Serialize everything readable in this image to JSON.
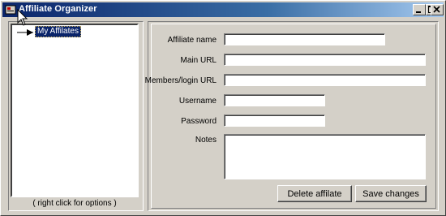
{
  "window": {
    "title": "Affiliate Organizer",
    "minimize_icon": "minimize-icon",
    "maximize_icon": "maximize-icon",
    "close_icon": "close-icon"
  },
  "tree": {
    "root_label": "My Affilates",
    "hint": "( right click for options )"
  },
  "form": {
    "affiliate_name_label": "Affiliate name",
    "main_url_label": "Main URL",
    "members_url_label": "Members/login URL",
    "username_label": "Username",
    "password_label": "Password",
    "notes_label": "Notes",
    "affiliate_name_value": "",
    "main_url_value": "",
    "members_url_value": "",
    "username_value": "",
    "password_value": "",
    "notes_value": ""
  },
  "buttons": {
    "delete_label": "Delete affilate",
    "save_label": "Save changes"
  }
}
